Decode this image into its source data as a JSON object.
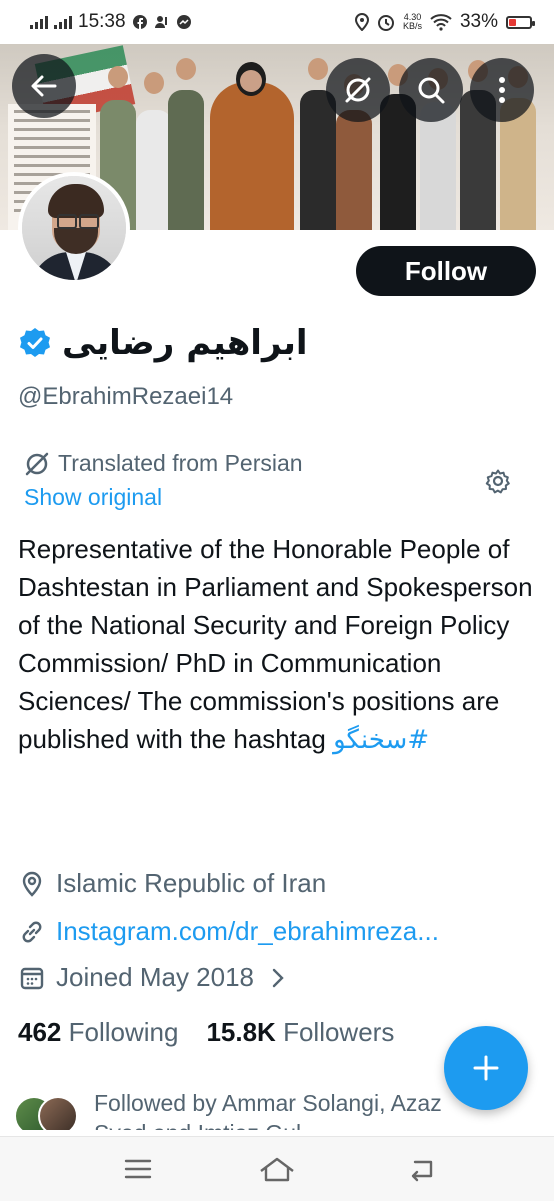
{
  "status_bar": {
    "time": "15:38",
    "net_speed_value": "4.30",
    "net_speed_unit": "KB/s",
    "battery": "33%",
    "battery_level": 0.33
  },
  "profile": {
    "display_name": "ابراهیم رضایی",
    "handle": "@EbrahimRezaei14",
    "follow_label": "Follow",
    "translated_label": "Translated from Persian",
    "show_original_label": "Show original",
    "bio_text": "Representative of the Honorable People of Dashtestan in Parliament and Spokesperson of the National Security and Foreign Policy Commission/ PhD in Communication Sciences/ The commission's positions are published with the hashtag ",
    "bio_hashtag": "#سخنگو",
    "location": "Islamic Republic of Iran",
    "link": "Instagram.com/dr_ebrahimreza...",
    "joined": "Joined May 2018",
    "following_count": "462",
    "following_label": "Following",
    "followers_count": "15.8K",
    "followers_label": "Followers",
    "followed_by": "Followed by Ammar Solangi, Azaz Syed and Imtiaz Gul"
  },
  "colors": {
    "accent": "#1d9bf0",
    "text_primary": "#0f1419",
    "text_secondary": "#536471",
    "battery_low": "#e53935"
  },
  "icons": {
    "back": "arrow-left-icon",
    "translate": "translate-slash-icon",
    "search": "search-icon",
    "more": "more-vertical-icon",
    "verified": "verified-badge-icon",
    "settings": "gear-icon",
    "location": "location-pin-icon",
    "link": "link-icon",
    "calendar": "calendar-icon",
    "compose": "plus-icon"
  }
}
